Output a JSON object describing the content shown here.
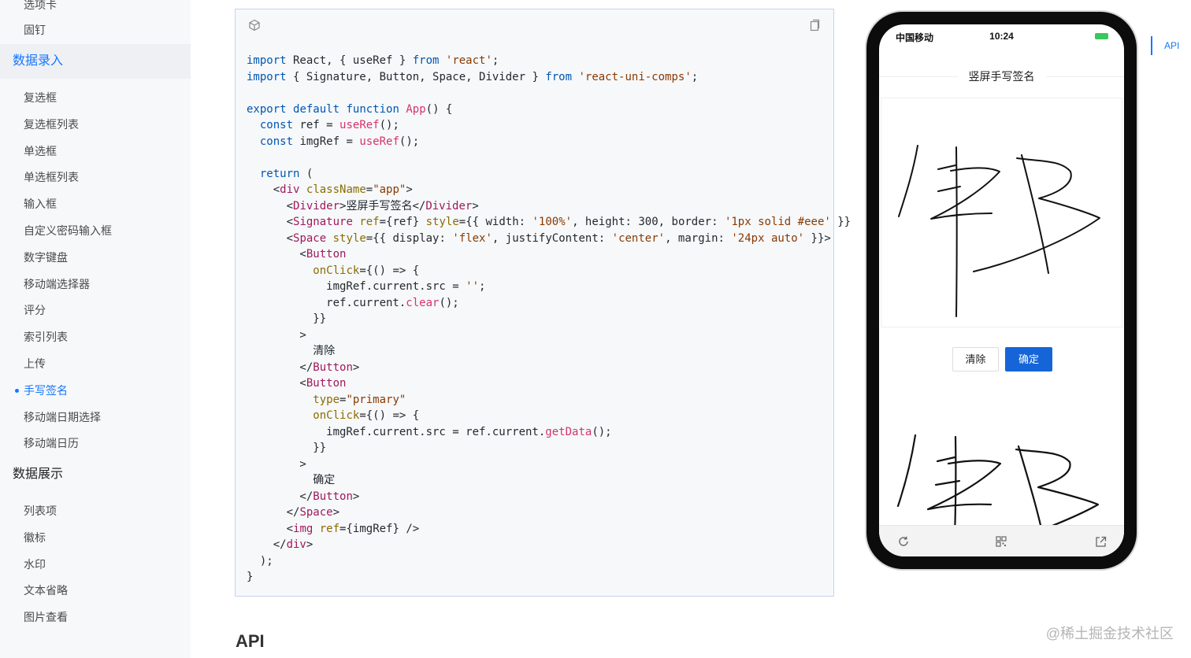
{
  "sidebar": {
    "top_cut_item": "选项卡",
    "pin_item": "固钉",
    "group_input": "数据录入",
    "input_items": [
      "复选框",
      "复选框列表",
      "单选框",
      "单选框列表",
      "输入框",
      "自定义密码输入框",
      "数字键盘",
      "移动端选择器",
      "评分",
      "索引列表",
      "上传",
      "手写签名",
      "移动端日期选择",
      "移动端日历"
    ],
    "active_index": 11,
    "group_display": "数据展示",
    "display_items": [
      "列表项",
      "徽标",
      "水印",
      "文本省略",
      "图片查看"
    ]
  },
  "code": {
    "lines": [
      "import React, { useRef } from 'react';",
      "import { Signature, Button, Space, Divider } from 'react-uni-comps';",
      "",
      "export default function App() {",
      "  const ref = useRef();",
      "  const imgRef = useRef();",
      "",
      "  return (",
      "    <div className=\"app\">",
      "      <Divider>竖屏手写签名</Divider>",
      "      <Signature ref={ref} style={{ width: '100%', height: 300, border: '1px solid #eee' }}",
      "      <Space style={{ display: 'flex', justifyContent: 'center', margin: '24px auto' }}>",
      "        <Button",
      "          onClick={() => {",
      "            imgRef.current.src = '';",
      "            ref.current.clear();",
      "          }}",
      "        >",
      "          清除",
      "        </Button>",
      "        <Button",
      "          type=\"primary\"",
      "          onClick={() => {",
      "            imgRef.current.src = ref.current.getData();",
      "          }}",
      "        >",
      "          确定",
      "        </Button>",
      "      </Space>",
      "      <img ref={imgRef} />",
      "    </div>",
      "  );",
      "}"
    ]
  },
  "phone": {
    "carrier": "中国移动",
    "time": "10:24",
    "divider_title": "竖屏手写签名",
    "clear_label": "清除",
    "confirm_label": "确定"
  },
  "toc": {
    "api": "API"
  },
  "api_heading": "API",
  "watermark": "@稀土掘金技术社区",
  "colors": {
    "accent": "#1677ff",
    "primary_button": "#1565d8",
    "battery": "#39c85a"
  },
  "icons": [
    "codesandbox-icon",
    "copy-icon",
    "refresh-icon",
    "qrcode-icon",
    "external-link-icon"
  ]
}
